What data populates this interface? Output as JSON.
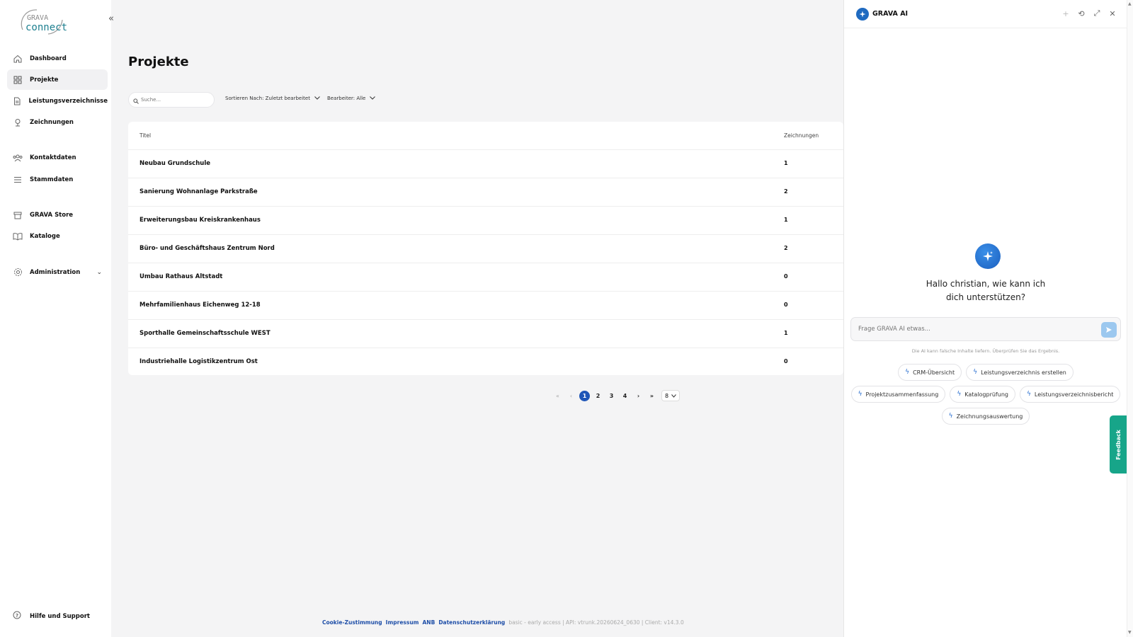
{
  "app": {
    "logo_top": "GRAVA",
    "logo_bottom": "connect"
  },
  "sidebar": {
    "items": [
      {
        "label": "Dashboard",
        "icon": "home-icon"
      },
      {
        "label": "Projekte",
        "icon": "grid-icon",
        "active": true
      },
      {
        "label": "Leistungsverzeichnisse",
        "icon": "document-icon"
      },
      {
        "label": "Zeichnungen",
        "icon": "pin-icon"
      },
      {
        "label": "Kontaktdaten",
        "icon": "users-icon"
      },
      {
        "label": "Stammdaten",
        "icon": "list-icon"
      },
      {
        "label": "GRAVA Store",
        "icon": "store-icon"
      },
      {
        "label": "Kataloge",
        "icon": "book-icon"
      },
      {
        "label": "Administration",
        "icon": "gear-icon"
      }
    ],
    "help_label": "Hilfe und Support"
  },
  "main": {
    "title": "Projekte",
    "search_placeholder": "Suche...",
    "sort_label": "Sortieren Nach: Zuletzt bearbeitet",
    "editor_label": "Bearbeiter: Alle",
    "columns": [
      "Titel",
      "Zeichnungen"
    ],
    "rows": [
      {
        "title": "Neubau Grundschule",
        "drawings": "1"
      },
      {
        "title": "Sanierung Wohnanlage Parkstraße",
        "drawings": "2"
      },
      {
        "title": "Erweiterungsbau Kreiskrankenhaus",
        "drawings": "1"
      },
      {
        "title": "Büro- und Geschäftshaus Zentrum Nord",
        "drawings": "2"
      },
      {
        "title": "Umbau Rathaus Altstadt",
        "drawings": "0"
      },
      {
        "title": "Mehrfamilienhaus Eichenweg 12-18",
        "drawings": "0"
      },
      {
        "title": "Sporthalle Gemeinschaftsschule WEST",
        "drawings": "1"
      },
      {
        "title": "Industriehalle Logistikzentrum Ost",
        "drawings": "0"
      }
    ],
    "pagination": {
      "first": "«",
      "prev": "‹",
      "pages": [
        "1",
        "2",
        "3",
        "4"
      ],
      "current": "1",
      "next": "›",
      "last": "»",
      "page_size": "8"
    }
  },
  "footer": {
    "links": [
      "Cookie-Zustimmung",
      "Impressum",
      "ANB",
      "Datenschutzerklärung"
    ],
    "version": "basic - early access | API: vtrunk.20260624_0630 | Client: v14.3.0"
  },
  "ai": {
    "title": "GRAVA AI",
    "greeting_line1": "Hallo christian, wie kann ich",
    "greeting_line2": "dich unterstützen?",
    "input_placeholder": "Frage GRAVA AI etwas...",
    "disclaimer": "Die AI kann falsche Inhalte liefern. Überprüfen Sie das Ergebnis.",
    "chips_row1": [
      "CRM-Übersicht",
      "Leistungsverzeichnis erstellen"
    ],
    "chips_row2": [
      "Projektzusammenfassung",
      "Katalogprüfung",
      "Leistungsverzeichnisbericht"
    ],
    "chips_row3": [
      "Zeichnungsauswertung"
    ]
  },
  "feedback_label": "Feedback",
  "colors": {
    "accent": "#1f56b7",
    "feedback": "#17a589",
    "link": "#1f4fa8"
  }
}
